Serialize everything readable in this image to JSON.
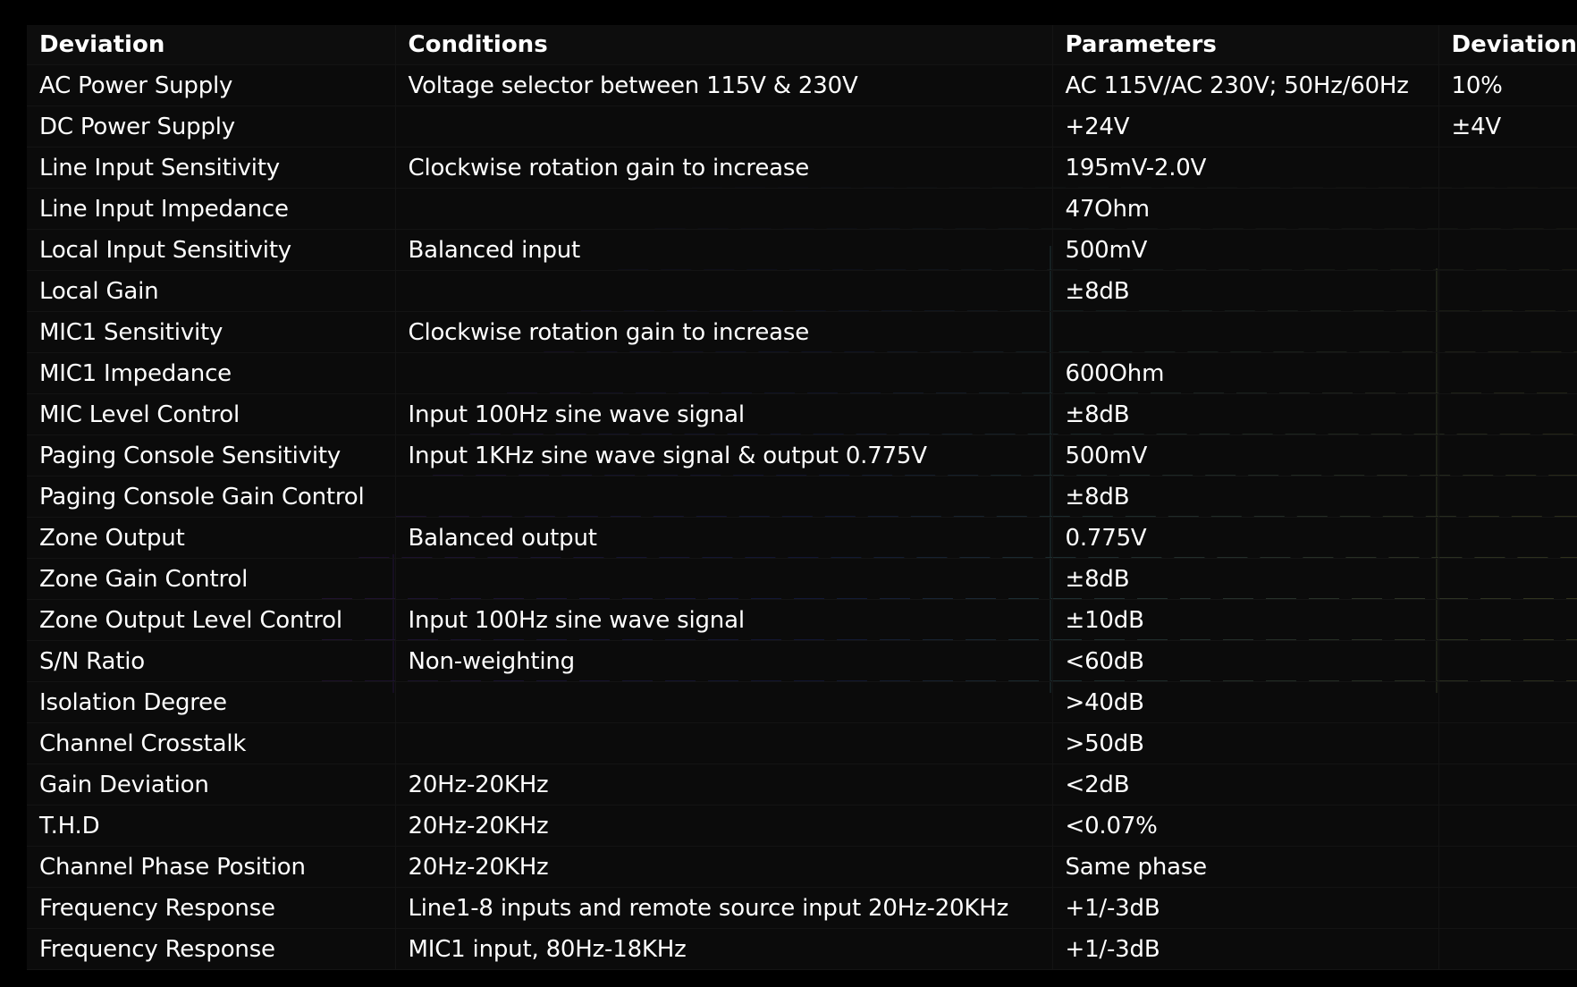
{
  "colors": {
    "background": "#000000",
    "table_background": "#0d0d0d",
    "text": "#ffffff",
    "grid_purple": "#7a2dd6",
    "grid_blue": "#2a4cff",
    "grid_cyan": "#6fd6e8",
    "grid_yellow": "#e8f06a"
  },
  "table": {
    "headers": [
      "Deviation",
      "Conditions",
      "Parameters",
      "Deviation"
    ],
    "rows": [
      [
        "AC Power Supply",
        "Voltage selector between 115V & 230V",
        "AC 115V/AC 230V; 50Hz/60Hz",
        "10%"
      ],
      [
        "DC Power Supply",
        "",
        "+24V",
        "±4V"
      ],
      [
        "Line Input Sensitivity",
        "Clockwise rotation gain to increase",
        "195mV-2.0V",
        ""
      ],
      [
        "Line Input Impedance",
        "",
        "47Ohm",
        ""
      ],
      [
        "Local Input Sensitivity",
        "Balanced input",
        "500mV",
        ""
      ],
      [
        "Local Gain",
        "",
        "±8dB",
        ""
      ],
      [
        "MIC1 Sensitivity",
        "Clockwise rotation gain to increase",
        "",
        ""
      ],
      [
        "MIC1 Impedance",
        "",
        "600Ohm",
        ""
      ],
      [
        "MIC Level Control",
        "Input 100Hz sine wave signal",
        "±8dB",
        ""
      ],
      [
        "Paging Console Sensitivity",
        "Input 1KHz sine wave signal & output 0.775V",
        "500mV",
        ""
      ],
      [
        "Paging Console Gain Control",
        "",
        "±8dB",
        ""
      ],
      [
        "Zone Output",
        "Balanced output",
        "0.775V",
        ""
      ],
      [
        "Zone Gain Control",
        "",
        "±8dB",
        ""
      ],
      [
        "Zone Output Level Control",
        "Input 100Hz sine wave signal",
        "±10dB",
        ""
      ],
      [
        "S/N Ratio",
        "Non-weighting",
        "<60dB",
        ""
      ],
      [
        "Isolation Degree",
        "",
        ">40dB",
        ""
      ],
      [
        "Channel Crosstalk",
        "",
        ">50dB",
        ""
      ],
      [
        "Gain Deviation",
        "20Hz-20KHz",
        "<2dB",
        ""
      ],
      [
        "T.H.D",
        "20Hz-20KHz",
        "<0.07%",
        ""
      ],
      [
        "Channel Phase Position",
        "20Hz-20KHz",
        "Same phase",
        ""
      ],
      [
        "Frequency Response",
        "Line1-8 inputs and remote source input 20Hz-20KHz",
        "+1/-3dB",
        ""
      ],
      [
        "Frequency Response",
        "MIC1 input, 80Hz-18KHz",
        "+1/-3dB",
        ""
      ]
    ]
  }
}
